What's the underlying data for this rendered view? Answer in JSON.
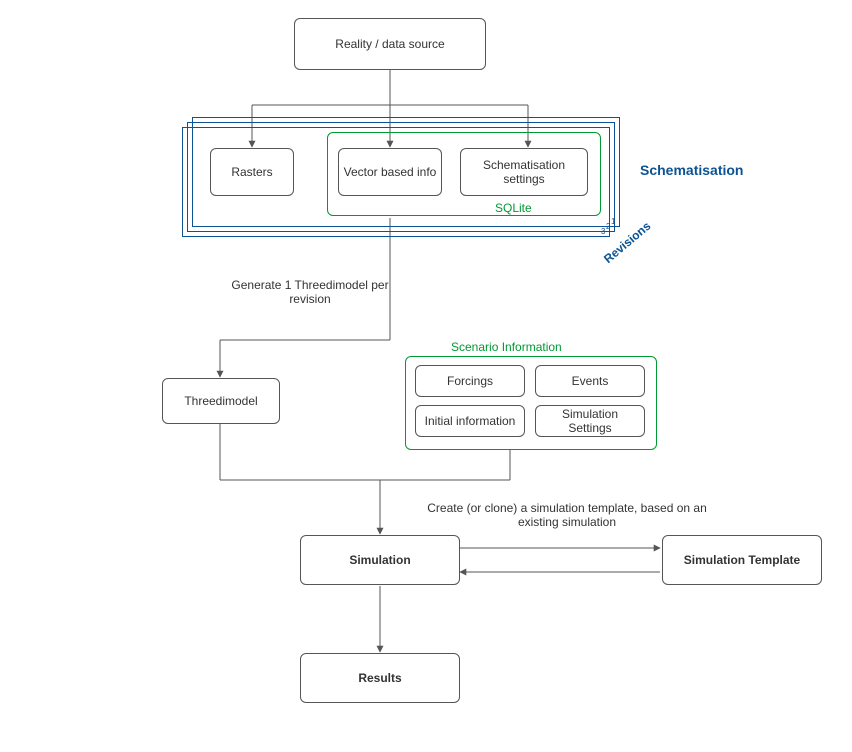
{
  "nodes": {
    "reality": "Reality / data source",
    "rasters": "Rasters",
    "vector": "Vector based info",
    "schem_settings": "Schematisation settings",
    "threedimodel": "Threedimodel",
    "forcings": "Forcings",
    "events": "Events",
    "initial": "Initial information",
    "sim_settings": "Simulation Settings",
    "simulation": "Simulation",
    "sim_template": "Simulation Template",
    "results": "Results"
  },
  "labels": {
    "generate": "Generate 1 Threedimodel per revision",
    "create_clone": "Create (or clone) a simulation template, based on an existing simulation",
    "schematisation": "Schematisation",
    "revisions": "Revisions",
    "sqlite": "SQLite",
    "scenario": "Scenario Information",
    "rev1": "1",
    "rev2": "2",
    "rev3": "3"
  },
  "chart_data": {
    "type": "flow-diagram",
    "nodes": [
      {
        "id": "reality",
        "label": "Reality / data source"
      },
      {
        "id": "rasters",
        "label": "Rasters"
      },
      {
        "id": "vector",
        "label": "Vector based info"
      },
      {
        "id": "schem_settings",
        "label": "Schematisation settings"
      },
      {
        "id": "threedimodel",
        "label": "Threedimodel"
      },
      {
        "id": "forcings",
        "label": "Forcings"
      },
      {
        "id": "events",
        "label": "Events"
      },
      {
        "id": "initial",
        "label": "Initial information"
      },
      {
        "id": "sim_settings",
        "label": "Simulation Settings"
      },
      {
        "id": "simulation",
        "label": "Simulation"
      },
      {
        "id": "sim_template",
        "label": "Simulation Template"
      },
      {
        "id": "results",
        "label": "Results"
      }
    ],
    "groups": [
      {
        "id": "schematisation",
        "label": "Schematisation",
        "children": [
          "rasters",
          "vector",
          "schem_settings"
        ],
        "revisions": 3
      },
      {
        "id": "sqlite",
        "label": "SQLite",
        "children": [
          "vector",
          "schem_settings"
        ]
      },
      {
        "id": "scenario_info",
        "label": "Scenario Information",
        "children": [
          "forcings",
          "events",
          "initial",
          "sim_settings"
        ]
      }
    ],
    "edges": [
      {
        "from": "reality",
        "to": "rasters"
      },
      {
        "from": "reality",
        "to": "vector"
      },
      {
        "from": "reality",
        "to": "schem_settings"
      },
      {
        "from": "schematisation",
        "to": "threedimodel",
        "label": "Generate 1 Threedimodel per revision"
      },
      {
        "from": "threedimodel",
        "to": "simulation"
      },
      {
        "from": "scenario_info",
        "to": "simulation"
      },
      {
        "from": "simulation",
        "to": "sim_template",
        "label": "Create (or clone) a simulation template, based on an existing simulation",
        "bidirectional": true
      },
      {
        "from": "simulation",
        "to": "results"
      }
    ]
  }
}
